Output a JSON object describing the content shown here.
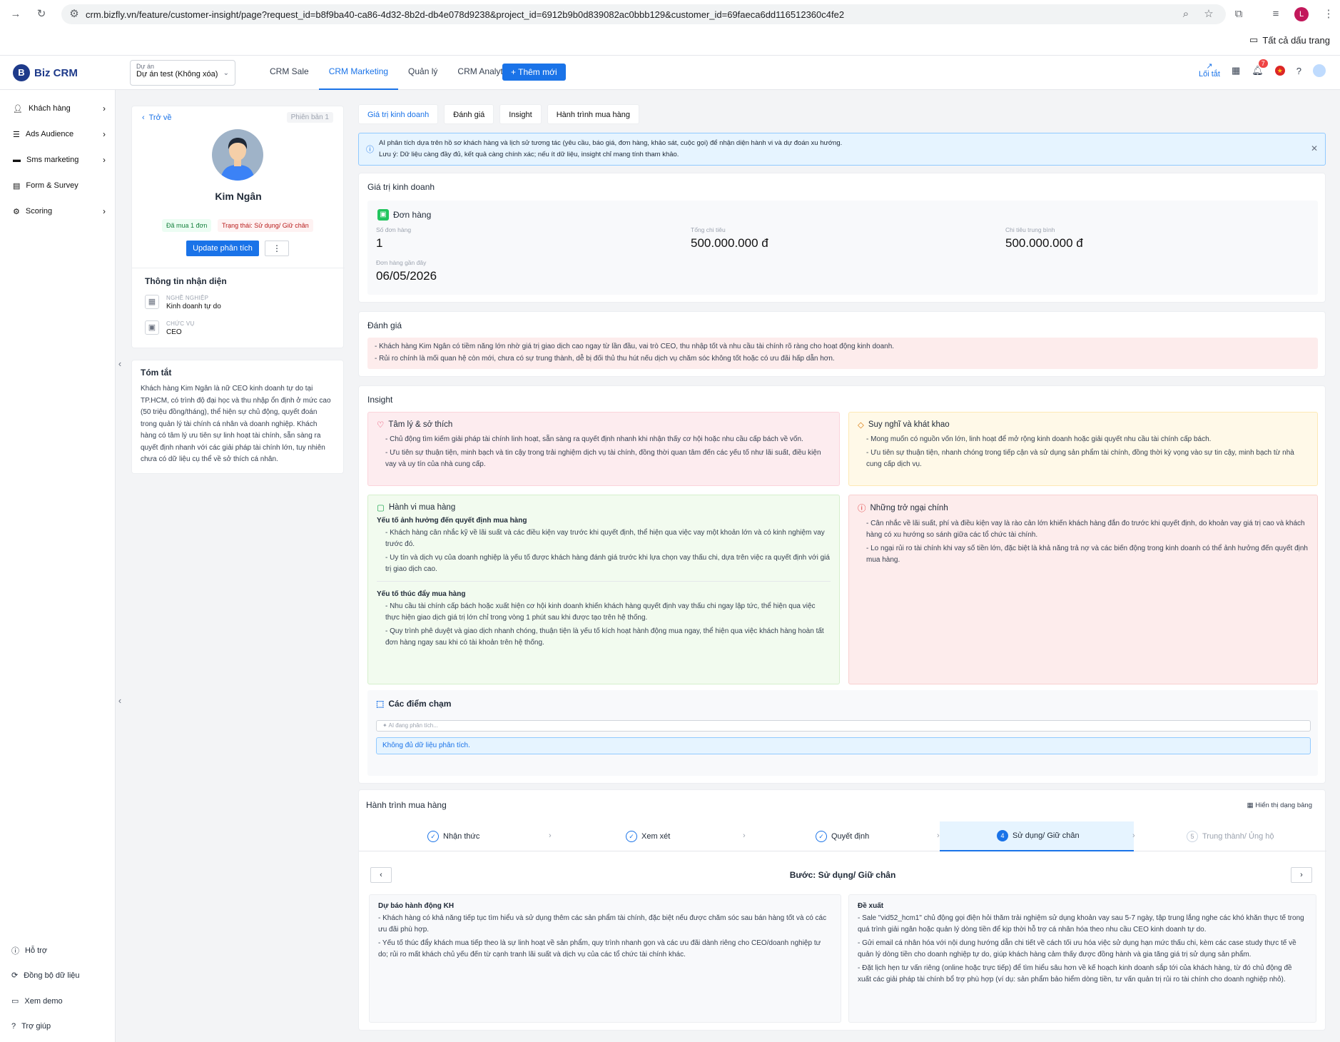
{
  "browser": {
    "url": "crm.bizfly.vn/feature/customer-insight/page?request_id=b8f9ba40-ca86-4d32-8b2d-db4e078d9238&project_id=6912b9b0d839082ac0bbb129&customer_id=69faeca6dd116512360c4fe2",
    "bookmarks": "Tất cả dấu trang",
    "profile": "L"
  },
  "app": {
    "logo": "Biz CRM",
    "project_label": "Dự án",
    "project_value": "Dự án test (Không xóa)",
    "nav": [
      "CRM Sale",
      "CRM Marketing",
      "Quản lý",
      "CRM Analytics"
    ],
    "add_new": "+ Thêm mới",
    "shortcut": "Lối tắt",
    "notif_count": "7"
  },
  "sidebar": {
    "items": [
      {
        "label": "Khách hàng",
        "icon": "person-icon"
      },
      {
        "label": "Ads Audience",
        "icon": "list-icon"
      },
      {
        "label": "Sms marketing",
        "icon": "chat-icon"
      },
      {
        "label": "Form & Survey",
        "icon": "clipboard-icon"
      },
      {
        "label": "Scoring",
        "icon": "gear-icon"
      }
    ],
    "bottom": [
      {
        "label": "Hỗ trợ",
        "icon": "info-icon"
      },
      {
        "label": "Đồng bộ dữ liệu",
        "icon": "sync-icon"
      },
      {
        "label": "Xem demo",
        "icon": "monitor-icon"
      },
      {
        "label": "Trợ giúp",
        "icon": "help-icon"
      }
    ]
  },
  "profile": {
    "back": "Trở về",
    "version": "Phiên bản 1",
    "name": "Kim Ngân",
    "tag_bought": "Đã mua 1 đơn",
    "tag_status": "Trạng thái: Sử dụng/ Giữ chân",
    "update_btn": "Update phân tích",
    "more": "⋮",
    "section": "Thông tin nhận diện",
    "job_label": "NGHỀ NGHIỆP",
    "job_value": "Kinh doanh tự do",
    "role_label": "CHỨC VỤ",
    "role_value": "CEO"
  },
  "summary": {
    "title": "Tóm tắt",
    "text": "Khách hàng Kim Ngân là nữ CEO kinh doanh tự do tại TP.HCM, có trình độ đại học và thu nhập ổn định ở mức cao (50 triệu đồng/tháng), thể hiện sự chủ động, quyết đoán trong quản lý tài chính cá nhân và doanh nghiệp. Khách hàng có tâm lý ưu tiên sự linh hoạt tài chính, sẵn sàng ra quyết định nhanh với các giải pháp tài chính lớn, tuy nhiên chưa có dữ liệu cụ thể về sở thích cá nhân."
  },
  "tabs": [
    "Giá trị kinh doanh",
    "Đánh giá",
    "Insight",
    "Hành trình mua hàng"
  ],
  "ai_notice": {
    "line1": "AI phân tích dựa trên hồ sơ khách hàng và lịch sử tương tác (yêu cầu, báo giá, đơn hàng, khảo sát, cuộc gọi) để nhận diện hành vi và dự đoán xu hướng.",
    "line2": "Lưu ý: Dữ liệu càng đầy đủ, kết quả càng chính xác; nếu ít dữ liệu, insight chỉ mang tính tham khảo."
  },
  "business": {
    "title": "Giá trị kinh doanh",
    "orders_title": "Đơn hàng",
    "order_count_label": "Số đơn hàng",
    "order_count": "1",
    "total_label": "Tổng chi tiêu",
    "total": "500.000.000 đ",
    "avg_label": "Chi tiêu trung bình",
    "avg": "500.000.000 đ",
    "recent_label": "Đơn hàng gần đây",
    "recent": "06/05/2026"
  },
  "evaluation": {
    "title": "Đánh giá",
    "lines": [
      "- Khách hàng Kim Ngân có tiềm năng lớn nhờ giá trị giao dịch cao ngay từ lần đầu, vai trò CEO, thu nhập tốt và nhu cầu tài chính rõ ràng cho hoạt động kinh doanh.",
      "- Rủi ro chính là mối quan hệ còn mới, chưa có sự trung thành, dễ bị đối thủ thu hút nếu dịch vụ chăm sóc không tốt hoặc có ưu đãi hấp dẫn hơn."
    ]
  },
  "insight": {
    "title": "Insight",
    "psych": {
      "title": "Tâm lý & sở thích",
      "lines": [
        "- Chủ động tìm kiếm giải pháp tài chính linh hoạt, sẵn sàng ra quyết định nhanh khi nhận thấy cơ hội hoặc nhu cầu cấp bách về vốn.",
        "- Ưu tiên sự thuận tiện, minh bạch và tin cậy trong trải nghiệm dịch vụ tài chính, đồng thời quan tâm đến các yếu tố như lãi suất, điều kiện vay và uy tín của nhà cung cấp."
      ]
    },
    "thoughts": {
      "title": "Suy nghĩ và khát khao",
      "lines": [
        "- Mong muốn có nguồn vốn lớn, linh hoạt để mở rộng kinh doanh hoặc giải quyết nhu cầu tài chính cấp bách.",
        "- Ưu tiên sự thuận tiện, nhanh chóng trong tiếp cận và sử dụng sản phẩm tài chính, đồng thời kỳ vọng vào sự tin cậy, minh bạch từ nhà cung cấp dịch vụ."
      ]
    },
    "behavior": {
      "title": "Hành vi mua hàng",
      "sub1": "Yếu tố ảnh hưởng đến quyết định mua hàng",
      "lines1": [
        "- Khách hàng cân nhắc kỹ về lãi suất và các điều kiện vay trước khi quyết định, thể hiện qua việc vay một khoản lớn và có kinh nghiệm vay trước đó.",
        "- Uy tín và dịch vụ của doanh nghiệp là yếu tố được khách hàng đánh giá trước khi lựa chọn vay thấu chi, dựa trên việc ra quyết định với giá trị giao dịch cao."
      ],
      "sub2": "Yếu tố thúc đẩy mua hàng",
      "lines2": [
        "- Nhu cầu tài chính cấp bách hoặc xuất hiện cơ hội kinh doanh khiến khách hàng quyết định vay thấu chi ngay lập tức, thể hiện qua việc thực hiện giao dịch giá trị lớn chỉ trong vòng 1 phút sau khi được tạo trên hệ thống.",
        "- Quy trình phê duyệt và giao dịch nhanh chóng, thuận tiện là yếu tố kích hoạt hành động mua ngay, thể hiện qua việc khách hàng hoàn tất đơn hàng ngay sau khi có tài khoản trên hệ thống."
      ]
    },
    "barriers": {
      "title": "Những trở ngại chính",
      "lines": [
        "- Cân nhắc về lãi suất, phí và điều kiện vay là rào cản lớn khiến khách hàng đắn đo trước khi quyết định, do khoản vay giá trị cao và khách hàng có xu hướng so sánh giữa các tổ chức tài chính.",
        "- Lo ngại rủi ro tài chính khi vay số tiền lớn, đặc biệt là khả năng trả nợ và các biến động trong kinh doanh có thể ảnh hưởng đến quyết định mua hàng."
      ]
    },
    "touch": {
      "title": "Các điểm chạm",
      "placeholder": "AI đang phân tích...",
      "empty": "Không đủ dữ liệu phân tích."
    }
  },
  "journey": {
    "title": "Hành trình mua hàng",
    "table_view": "Hiển thị dạng bảng",
    "steps": [
      "Nhận thức",
      "Xem xét",
      "Quyết định",
      "Sử dụng/ Giữ chân",
      "Trung thành/ Ủng hộ"
    ],
    "step4_num": "4",
    "step5_num": "5",
    "current": "Bước: Sử dụng/ Giữ chân",
    "forecast": {
      "title": "Dự báo hành động KH",
      "lines": [
        "- Khách hàng có khả năng tiếp tục tìm hiểu và sử dụng thêm các sản phẩm tài chính, đặc biệt nếu được chăm sóc sau bán hàng tốt và có các ưu đãi phù hợp.",
        "- Yếu tố thúc đẩy khách mua tiếp theo là sự linh hoạt về sản phẩm, quy trình nhanh gọn và các ưu đãi dành riêng cho CEO/doanh nghiệp tư do; rủi ro mất khách chủ yếu đến từ cạnh tranh lãi suất và dịch vụ của các tổ chức tài chính khác."
      ]
    },
    "suggest": {
      "title": "Đề xuất",
      "lines": [
        "- Sale \"vid52_hcm1\" chủ động gọi điện hỏi thăm trải nghiệm sử dụng khoản vay sau 5-7 ngày, tập trung lắng nghe các khó khăn thực tế trong quá trình giải ngân hoặc quản lý dòng tiền để kịp thời hỗ trợ cá nhân hóa theo nhu cầu CEO kinh doanh tự do.",
        "- Gửi email cá nhân hóa với nội dung hướng dẫn chi tiết về cách tối ưu hóa việc sử dụng hạn mức thấu chi, kèm các case study thực tế về quản lý dòng tiền cho doanh nghiệp tự do, giúp khách hàng cảm thấy được đồng hành và gia tăng giá trị sử dụng sản phẩm.",
        "- Đặt lịch hẹn tư vấn riêng (online hoặc trực tiếp) để tìm hiểu sâu hơn về kế hoạch kinh doanh sắp tới của khách hàng, từ đó chủ động đề xuất các giải pháp tài chính bổ trợ phù hợp (ví dụ: sản phẩm bảo hiểm dòng tiền, tư vấn quản trị rủi ro tài chính cho doanh nghiệp nhỏ)."
      ]
    }
  }
}
